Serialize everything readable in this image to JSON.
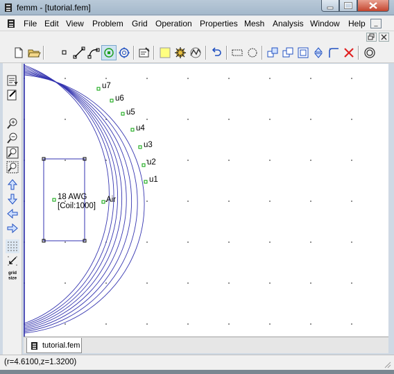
{
  "window": {
    "title": "femm - [tutorial.fem]",
    "icon": "femm-app-icon"
  },
  "menu": [
    "File",
    "Edit",
    "View",
    "Problem",
    "Grid",
    "Operation",
    "Properties",
    "Mesh",
    "Analysis",
    "Window",
    "Help"
  ],
  "toolbar": {
    "icons": [
      "new-document-icon",
      "open-folder-icon",
      "node-mode-icon",
      "segment-mode-icon",
      "arc-segment-mode-icon",
      "block-label-mode-icon",
      "group-mode-icon",
      "problem-definition-icon",
      "material-library-icon",
      "mesh-icon",
      "run-solver-icon",
      "view-results-icon",
      "undo-icon",
      "select-rectangle-icon",
      "select-circle-icon",
      "move-icon",
      "copy-icon",
      "scale-icon",
      "mirror-icon",
      "fillet-icon",
      "delete-icon",
      "circle-props-icon"
    ]
  },
  "left_toolbar": {
    "icons": [
      "snap-grid-icon",
      "show-names-icon",
      "zoom-in-icon",
      "zoom-out-icon",
      "zoom-natural-icon",
      "zoom-window-icon",
      "pan-up-icon",
      "pan-down-icon",
      "pan-left-icon",
      "pan-right-icon",
      "show-grid-icon",
      "snap-grid-toggle-icon",
      "grid-size-icon"
    ],
    "grid_size_label": "grid size"
  },
  "canvas": {
    "labels": {
      "u7": "u7",
      "u6": "u6",
      "u5": "u5",
      "u4": "u4",
      "u3": "u3",
      "u2": "u2",
      "u1": "u1",
      "coil_material": "18 AWG",
      "coil_circuit": "[Coil:1000]",
      "air": "Air"
    },
    "colors": {
      "boundary": "#1a1aa0",
      "coil": "#3030b0",
      "node": "#00a000",
      "grid": "#404040"
    }
  },
  "tab": {
    "label": "tutorial.fem"
  },
  "status": {
    "text": "(r=4.6100,z=1.3200)"
  }
}
